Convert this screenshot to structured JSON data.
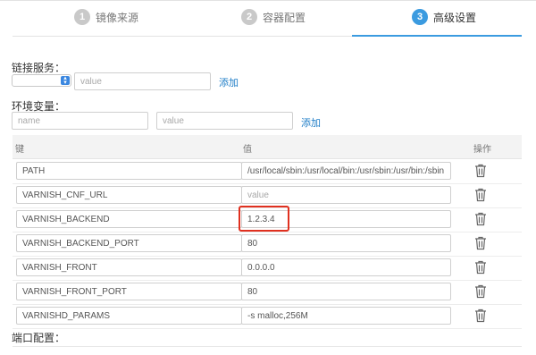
{
  "steps": [
    {
      "num": "1",
      "label": "镜像来源"
    },
    {
      "num": "2",
      "label": "容器配置"
    },
    {
      "num": "3",
      "label": "高级设置"
    }
  ],
  "link_service": {
    "label": "链接服务：",
    "value_placeholder": "value",
    "add_label": "添加"
  },
  "env": {
    "label": "环境变量：",
    "name_placeholder": "name",
    "value_placeholder": "value",
    "add_label": "添加",
    "columns": {
      "key": "键",
      "value": "值",
      "action": "操作"
    },
    "rows": [
      {
        "key": "PATH",
        "value": "/usr/local/sbin:/usr/local/bin:/usr/sbin:/usr/bin:/sbin:/bi"
      },
      {
        "key": "VARNISH_CNF_URL",
        "value": "",
        "value_placeholder": "value"
      },
      {
        "key": "VARNISH_BACKEND",
        "value": "1.2.3.4"
      },
      {
        "key": "VARNISH_BACKEND_PORT",
        "value": "80"
      },
      {
        "key": "VARNISH_FRONT",
        "value": "0.0.0.0"
      },
      {
        "key": "VARNISH_FRONT_PORT",
        "value": "80"
      },
      {
        "key": "VARNISHD_PARAMS",
        "value": "-s malloc,256M"
      }
    ]
  },
  "port_config": {
    "label": "端口配置："
  },
  "colors": {
    "accent": "#3b9be0",
    "link": "#1e7dc7",
    "highlight": "#e0301f"
  }
}
